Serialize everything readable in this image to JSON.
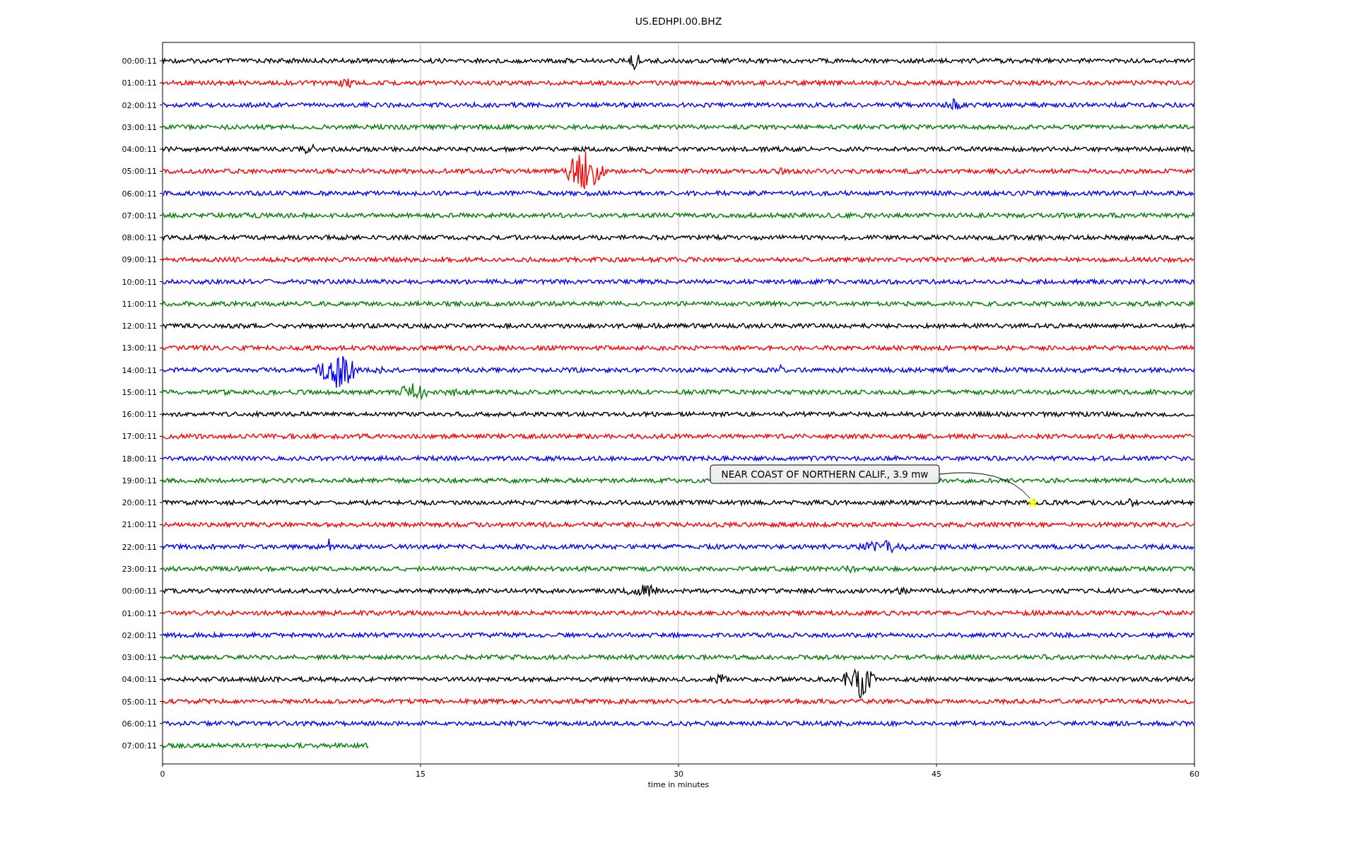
{
  "title": "US.EDHPI.00.BHZ",
  "xlabel": "time in minutes",
  "xticks": [
    "0",
    "15",
    "30",
    "45",
    "60"
  ],
  "rows": [
    {
      "label": "00:00:11",
      "color": "#000000",
      "kind": "full"
    },
    {
      "label": "01:00:11",
      "color": "#ff0000",
      "kind": "full"
    },
    {
      "label": "02:00:11",
      "color": "#0000ff",
      "kind": "full"
    },
    {
      "label": "03:00:11",
      "color": "#008000",
      "kind": "full"
    },
    {
      "label": "04:00:11",
      "color": "#000000",
      "kind": "full"
    },
    {
      "label": "05:00:11",
      "color": "#ff0000",
      "kind": "full"
    },
    {
      "label": "06:00:11",
      "color": "#0000ff",
      "kind": "full"
    },
    {
      "label": "07:00:11",
      "color": "#008000",
      "kind": "full"
    },
    {
      "label": "08:00:11",
      "color": "#000000",
      "kind": "full"
    },
    {
      "label": "09:00:11",
      "color": "#ff0000",
      "kind": "full"
    },
    {
      "label": "10:00:11",
      "color": "#0000ff",
      "kind": "full"
    },
    {
      "label": "11:00:11",
      "color": "#008000",
      "kind": "full"
    },
    {
      "label": "12:00:11",
      "color": "#000000",
      "kind": "full"
    },
    {
      "label": "13:00:11",
      "color": "#ff0000",
      "kind": "full"
    },
    {
      "label": "14:00:11",
      "color": "#0000ff",
      "kind": "full"
    },
    {
      "label": "15:00:11",
      "color": "#008000",
      "kind": "full"
    },
    {
      "label": "16:00:11",
      "color": "#000000",
      "kind": "full"
    },
    {
      "label": "17:00:11",
      "color": "#ff0000",
      "kind": "full"
    },
    {
      "label": "18:00:11",
      "color": "#0000ff",
      "kind": "full"
    },
    {
      "label": "19:00:11",
      "color": "#008000",
      "kind": "full"
    },
    {
      "label": "20:00:11",
      "color": "#000000",
      "kind": "full"
    },
    {
      "label": "21:00:11",
      "color": "#ff0000",
      "kind": "full"
    },
    {
      "label": "22:00:11",
      "color": "#0000ff",
      "kind": "full"
    },
    {
      "label": "23:00:11",
      "color": "#008000",
      "kind": "full"
    },
    {
      "label": "00:00:11",
      "color": "#000000",
      "kind": "full"
    },
    {
      "label": "01:00:11",
      "color": "#ff0000",
      "kind": "full"
    },
    {
      "label": "02:00:11",
      "color": "#0000ff",
      "kind": "full"
    },
    {
      "label": "03:00:11",
      "color": "#008000",
      "kind": "full"
    },
    {
      "label": "04:00:11",
      "color": "#000000",
      "kind": "full"
    },
    {
      "label": "05:00:11",
      "color": "#ff0000",
      "kind": "full"
    },
    {
      "label": "06:00:11",
      "color": "#0000ff",
      "kind": "full"
    },
    {
      "label": "07:00:11",
      "color": "#008000",
      "kind": "partial"
    }
  ],
  "event": {
    "label": "NEAR COAST OF NORTHERN CALIF., 3.9 mw"
  }
}
